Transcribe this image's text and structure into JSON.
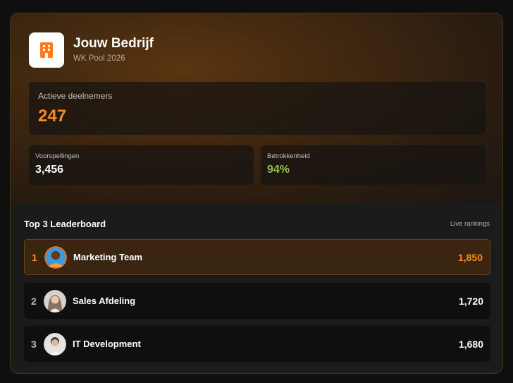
{
  "company": {
    "name": "Jouw Bedrijf",
    "subtitle": "WK Pool 2026",
    "logo_icon": "building-icon",
    "accent_color": "#ff8a1e"
  },
  "stats": {
    "active": {
      "label": "Actieve deelnemers",
      "value": "247"
    },
    "predictions": {
      "label": "Voorspellingen",
      "value": "3,456"
    },
    "engagement": {
      "label": "Betrokkenheid",
      "value": "94%"
    }
  },
  "leaderboard": {
    "title": "Top 3 Leaderboard",
    "subtitle": "Live rankings",
    "rows": [
      {
        "rank": "1",
        "name": "Marketing Team",
        "score": "1,850"
      },
      {
        "rank": "2",
        "name": "Sales Afdeling",
        "score": "1,720"
      },
      {
        "rank": "3",
        "name": "IT Development",
        "score": "1,680"
      }
    ]
  }
}
